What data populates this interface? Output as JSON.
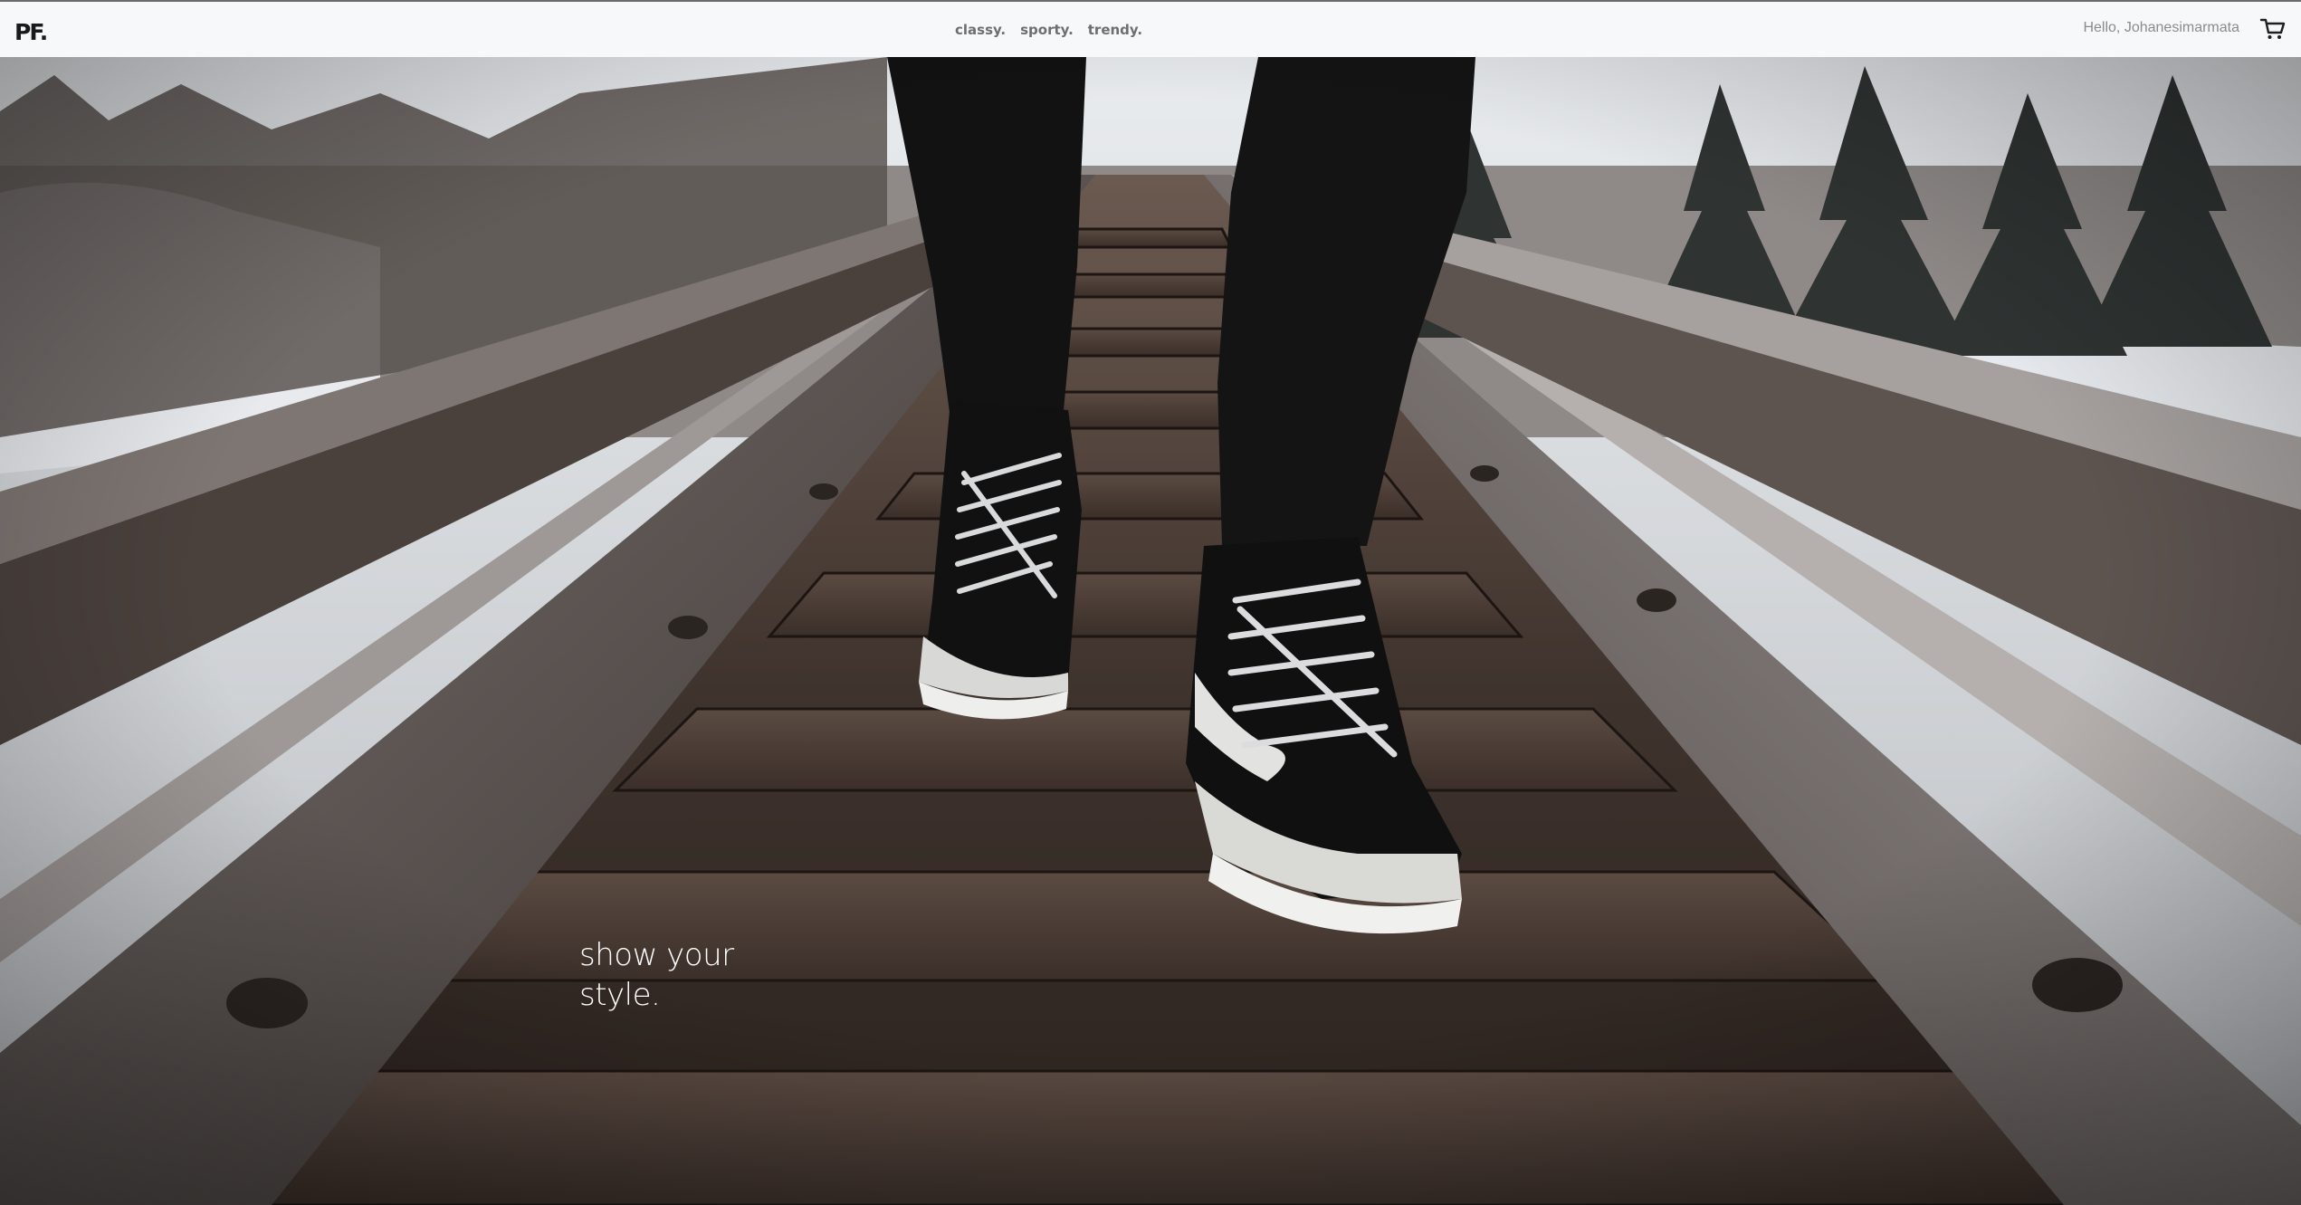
{
  "brand": {
    "logo_text": "PF."
  },
  "nav": {
    "links": [
      {
        "label": "classy."
      },
      {
        "label": "sporty."
      },
      {
        "label": "trendy."
      }
    ]
  },
  "user": {
    "greeting": "Hello, Johanesimarmata"
  },
  "cart": {
    "icon": "shopping-cart-icon"
  },
  "hero": {
    "image": "sneakers-on-railway-track",
    "tagline_line1": "show your",
    "tagline_line2": "style."
  },
  "colors": {
    "navbar_bg": "#f7f8f9",
    "brand": "#1a1a1a",
    "nav_link": "#6e6e6e",
    "greeting": "#8b8b8b",
    "tagline": "#ffffff"
  }
}
